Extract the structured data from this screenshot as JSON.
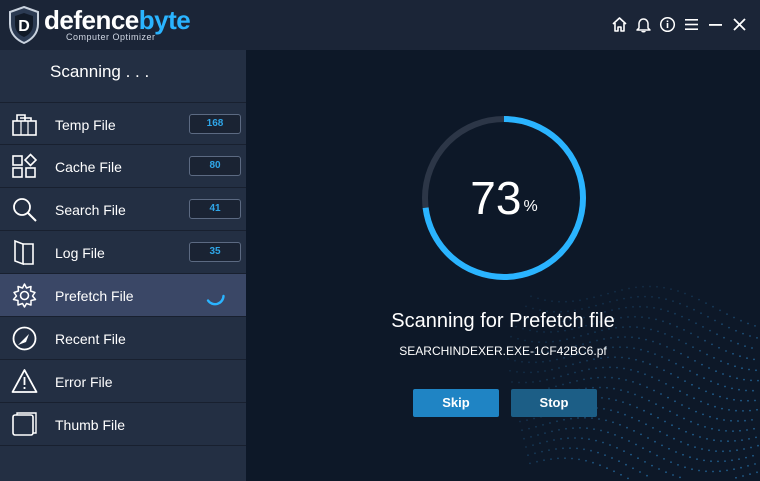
{
  "app": {
    "brand_part1": "defence",
    "brand_part2": "byte",
    "tagline": "Computer Optimizer"
  },
  "titlebar_icons": [
    "home-icon",
    "bell-icon",
    "info-icon",
    "menu-icon",
    "minimize-icon",
    "close-icon"
  ],
  "sidebar": {
    "status_title": "Scanning . . .",
    "items": [
      {
        "label": "Temp File",
        "count": "168",
        "icon": "temp-file-icon"
      },
      {
        "label": "Cache File",
        "count": "80",
        "icon": "cache-file-icon"
      },
      {
        "label": "Search File",
        "count": "41",
        "icon": "search-file-icon"
      },
      {
        "label": "Log File",
        "count": "35",
        "icon": "log-file-icon"
      },
      {
        "label": "Prefetch File",
        "count": "",
        "icon": "prefetch-file-icon",
        "state": "scanning"
      },
      {
        "label": "Recent File",
        "count": "",
        "icon": "recent-file-icon"
      },
      {
        "label": "Error File",
        "count": "",
        "icon": "error-file-icon"
      },
      {
        "label": "Thumb File",
        "count": "",
        "icon": "thumb-file-icon"
      }
    ]
  },
  "main": {
    "progress_value": "73",
    "progress_symbol": "%",
    "progress_fraction": 0.73,
    "scan_message": "Scanning for Prefetch file",
    "current_file": "SEARCHINDEXER.EXE-1CF42BC6.pf",
    "skip_label": "Skip",
    "stop_label": "Stop"
  },
  "colors": {
    "accent": "#2ab4ff",
    "titlebar_bg": "#1b2537",
    "sidebar_bg": "#232f43",
    "active_item_bg": "#3a4766",
    "main_bg": "#0d1828",
    "skip_button": "#1f84c4",
    "stop_button": "#1c5e86"
  }
}
